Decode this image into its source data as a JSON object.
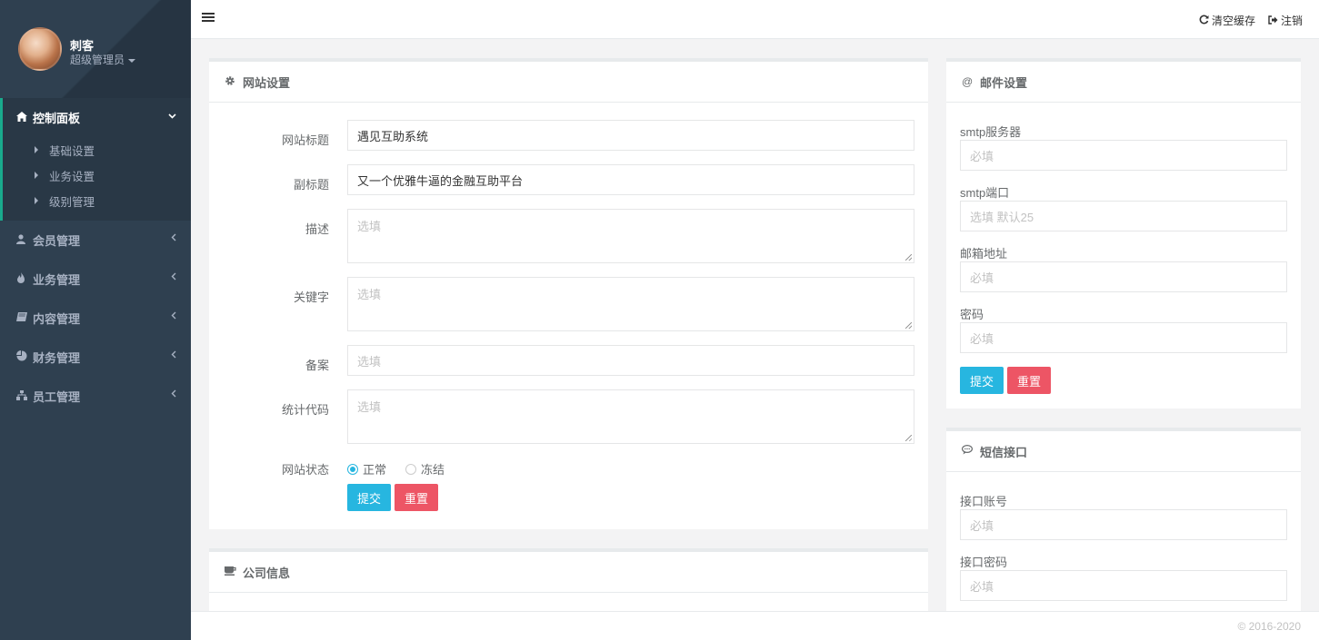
{
  "user": {
    "name": "刺客",
    "role": "超级管理员"
  },
  "sidebar": {
    "active": {
      "label": "控制面板",
      "icon": "home-icon",
      "sub": [
        "基础设置",
        "业务设置",
        "级别管理"
      ]
    },
    "items": [
      {
        "label": "会员管理",
        "icon": "user-icon"
      },
      {
        "label": "业务管理",
        "icon": "fire-icon"
      },
      {
        "label": "内容管理",
        "icon": "book-icon"
      },
      {
        "label": "财务管理",
        "icon": "pie-chart-icon"
      },
      {
        "label": "员工管理",
        "icon": "sitemap-icon"
      }
    ]
  },
  "topbar": {
    "clear_cache": "清空缓存",
    "logout": "注销"
  },
  "site": {
    "title": "网站设置",
    "labels": {
      "site_title": "网站标题",
      "subtitle": "副标题",
      "description": "描述",
      "keywords": "关键字",
      "icp": "备案",
      "stats": "统计代码",
      "status": "网站状态"
    },
    "values": {
      "site_title": "遇见互助系统",
      "subtitle": "又一个优雅牛逼的金融互助平台"
    },
    "placeholders": {
      "description": "选填",
      "keywords": "选填",
      "icp": "选填",
      "stats": "选填"
    },
    "status_options": [
      "正常",
      "冻结"
    ],
    "submit": "提交",
    "reset": "重置"
  },
  "company": {
    "title": "公司信息"
  },
  "mail": {
    "title": "邮件设置",
    "fields": [
      {
        "label": "smtp服务器",
        "placeholder": "必填"
      },
      {
        "label": "smtp端口",
        "placeholder": "选填 默认25"
      },
      {
        "label": "邮箱地址",
        "placeholder": "必填"
      },
      {
        "label": "密码",
        "placeholder": "必填"
      }
    ],
    "submit": "提交",
    "reset": "重置"
  },
  "sms": {
    "title": "短信接口",
    "fields": [
      {
        "label": "接口账号",
        "placeholder": "必填"
      },
      {
        "label": "接口密码",
        "placeholder": "必填"
      }
    ]
  },
  "footer": {
    "copyright": "© 2016-2020"
  },
  "colors": {
    "sidebar": "#2f4050",
    "info": "#27b6e0",
    "danger": "#ed5565"
  }
}
